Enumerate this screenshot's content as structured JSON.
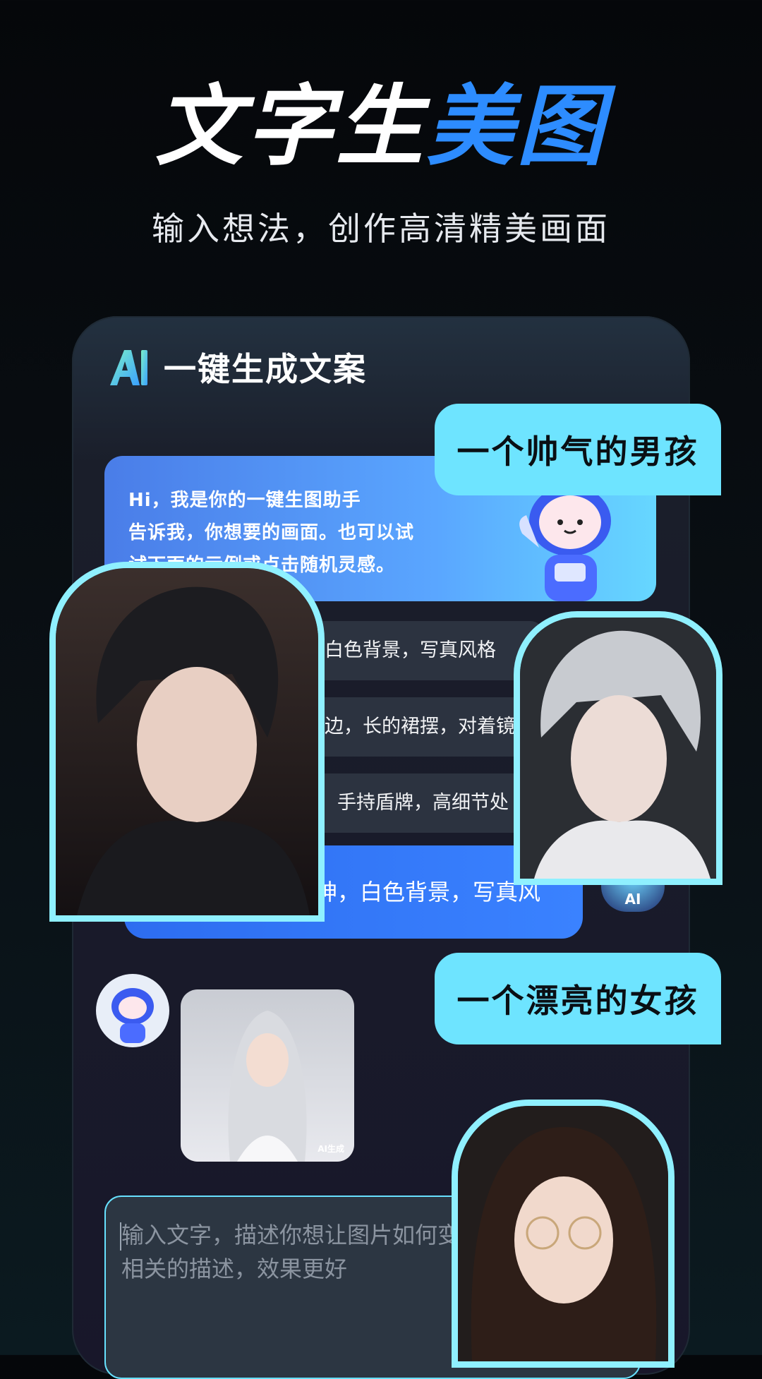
{
  "hero": {
    "title_white": "文字生",
    "title_blue": "美图",
    "subtitle": "输入想法，创作高清精美画面"
  },
  "app": {
    "header_title": "一键生成文案",
    "greeting": "Hi，我是你的一键生图助手\n告诉我，你想要的画面。也可以试\n试下面的示例或点击随机灵感。",
    "prompts": [
      "白色背景，写真风格",
      "边，长的裙摆，对着镜",
      "手持盾牌，高细节处"
    ],
    "user_message": "神，白色背景，写真风",
    "ai_avatar_label": "AI",
    "result_badge": "AI生成",
    "input_placeholder": "输入文字，描述你想让图片如何变\n相关的描述，效果更好"
  },
  "chips": {
    "boy": "一个帅气的男孩",
    "girl": "一个漂亮的女孩"
  },
  "colors": {
    "accent_blue": "#2d8cff",
    "chip_cyan": "#6ee4ff",
    "frame_cyan": "#8ff0ff"
  },
  "icons": {
    "logo": "ai-logo-icon",
    "mascot": "astronaut-mascot"
  }
}
